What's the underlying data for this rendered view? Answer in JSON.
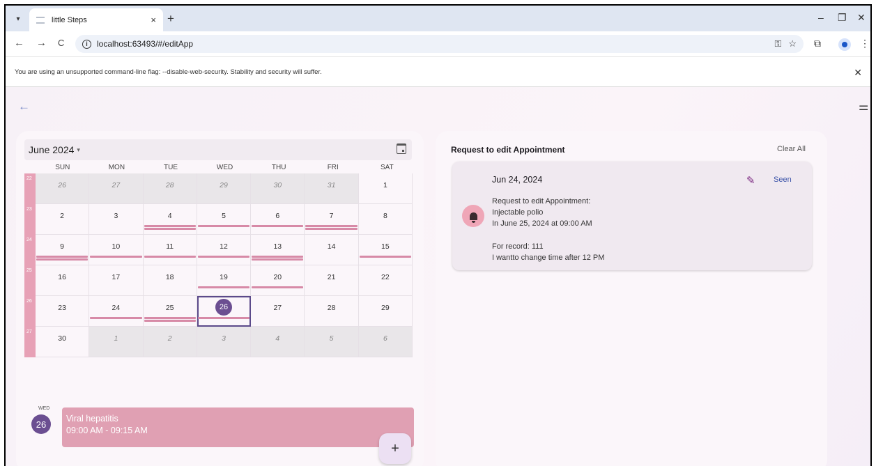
{
  "browser": {
    "tab_title": "little Steps",
    "tab_close": "×",
    "new_tab": "+",
    "url": "localhost:63493/#/editApp",
    "minimize": "–",
    "restore": "❐",
    "close": "✕",
    "back": "←",
    "forward": "→",
    "reload": "C",
    "info": "i",
    "key_icon": "⚿",
    "star": "☆",
    "extensions": "⧉",
    "menu": "⋮",
    "infobar_text": "You are using an unsupported command-line flag: --disable-web-security. Stability and security will suffer.",
    "infobar_close": "✕"
  },
  "app": {
    "back": "←",
    "filter": "⚌"
  },
  "calendar": {
    "month_label": "June 2024",
    "caret": "▾",
    "days_of_week": [
      "SUN",
      "MON",
      "TUE",
      "WED",
      "THU",
      "FRI",
      "SAT"
    ],
    "weeks": [
      {
        "num": "22",
        "days": [
          {
            "d": "26",
            "out": true
          },
          {
            "d": "27",
            "out": true
          },
          {
            "d": "28",
            "out": true
          },
          {
            "d": "29",
            "out": true
          },
          {
            "d": "30",
            "out": true
          },
          {
            "d": "31",
            "out": true
          },
          {
            "d": "1",
            "out": false
          }
        ]
      },
      {
        "num": "23",
        "days": [
          {
            "d": "2"
          },
          {
            "d": "3"
          },
          {
            "d": "4",
            "events": 2
          },
          {
            "d": "5",
            "events": 1
          },
          {
            "d": "6",
            "events": 1
          },
          {
            "d": "7",
            "events": 2
          },
          {
            "d": "8"
          }
        ]
      },
      {
        "num": "24",
        "days": [
          {
            "d": "9",
            "events": 2
          },
          {
            "d": "10",
            "events": 1
          },
          {
            "d": "11",
            "events": 1
          },
          {
            "d": "12",
            "events": 1
          },
          {
            "d": "13",
            "events": 2
          },
          {
            "d": "14"
          },
          {
            "d": "15",
            "events": 1
          }
        ]
      },
      {
        "num": "25",
        "days": [
          {
            "d": "16"
          },
          {
            "d": "17"
          },
          {
            "d": "18"
          },
          {
            "d": "19",
            "events": 1
          },
          {
            "d": "20",
            "events": 1
          },
          {
            "d": "21"
          },
          {
            "d": "22"
          }
        ]
      },
      {
        "num": "26",
        "days": [
          {
            "d": "23"
          },
          {
            "d": "24",
            "events": 1
          },
          {
            "d": "25",
            "events": 2
          },
          {
            "d": "26",
            "selected": true,
            "events": 1
          },
          {
            "d": "27"
          },
          {
            "d": "28"
          },
          {
            "d": "29"
          }
        ]
      },
      {
        "num": "27",
        "days": [
          {
            "d": "30"
          },
          {
            "d": "1",
            "out": true
          },
          {
            "d": "2",
            "out": true
          },
          {
            "d": "3",
            "out": true
          },
          {
            "d": "4",
            "out": true
          },
          {
            "d": "5",
            "out": true
          },
          {
            "d": "6",
            "out": true
          }
        ]
      }
    ],
    "agenda": {
      "dow": "WED",
      "day": "26",
      "event_title": "Viral hepatitis",
      "event_time": "09:00 AM - 09:15 AM"
    },
    "fab_label": "+"
  },
  "requests": {
    "title": "Request to edit Appointment",
    "clear_all": "Clear All",
    "notification": {
      "date": "Jun 24, 2024",
      "seen": "Seen",
      "line1": "Request to edit Appointment:",
      "line2": "Injectable polio",
      "line3": "In June 25, 2024 at 09:00 AM",
      "line4": "For record: 111",
      "line5": "I wantto change time after 12 PM"
    }
  },
  "colors": {
    "week_column": "#e7a1b6",
    "event_bar": "#d78aa7",
    "selected_day": "#6b4e91",
    "agenda_event": "#e0a0b3"
  }
}
